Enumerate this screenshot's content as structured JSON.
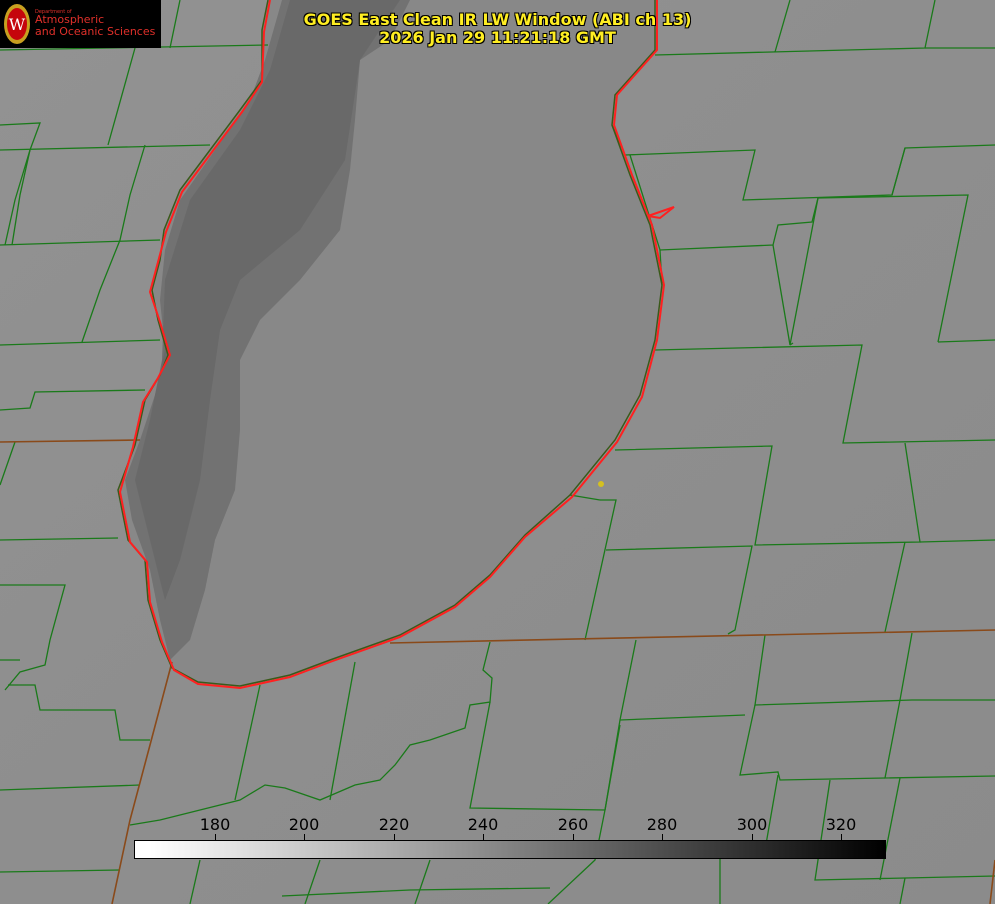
{
  "title": {
    "line1": "GOES East Clean IR LW Window (ABI ch 13)",
    "line2": "2026 Jan 29 11:21:18 GMT"
  },
  "logo": {
    "dept": "Department of",
    "line1": "Atmospheric",
    "line2": "and Oceanic Sciences",
    "seal_letter": "W"
  },
  "colorbar": {
    "ticks": [
      "180",
      "200",
      "220",
      "240",
      "260",
      "280",
      "300",
      "320"
    ]
  },
  "colors": {
    "county_lines": "#1a7a1a",
    "state_lines": "#8a4a1a",
    "coastline": "#ff2020",
    "title": "#ffee22",
    "marker": "#d4c020"
  }
}
